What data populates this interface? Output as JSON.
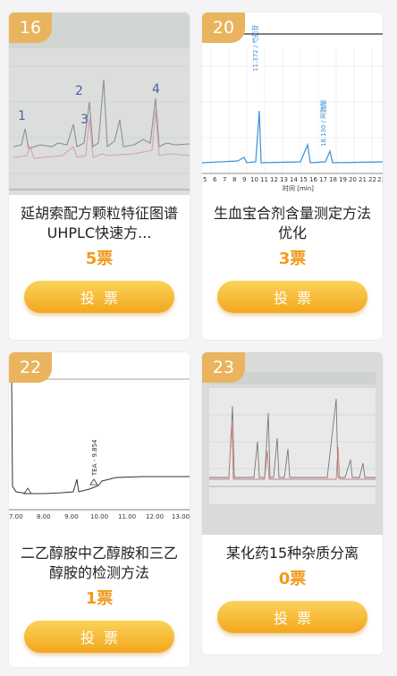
{
  "cards": [
    {
      "number": "16",
      "title": "延胡索配方颗粒特征图谱UHPLC快速方...",
      "votes": "5票",
      "vote_label": "投票",
      "peak_labels": [
        "1",
        "2",
        "3",
        "4"
      ]
    },
    {
      "number": "20",
      "title": "生血宝合剂含量测定方法优化",
      "votes": "3票",
      "vote_label": "投票",
      "axis_ticks": [
        "5",
        "6",
        "7",
        "8",
        "9",
        "10",
        "11",
        "12",
        "13",
        "14",
        "15",
        "16",
        "17",
        "18",
        "19",
        "20",
        "21",
        "22",
        "23"
      ],
      "axis_title": "时间 [min]",
      "peak_labels": [
        "11.372 / 芍药苷",
        "18.130 / 阿魏酸"
      ]
    },
    {
      "number": "22",
      "title": "二乙醇胺中乙醇胺和三乙醇胺的检测方法",
      "votes": "1票",
      "vote_label": "投票",
      "axis_ticks": [
        "7.00",
        "8.00",
        "9.00",
        "10.00",
        "11.00",
        "12.00",
        "13.00"
      ],
      "peak_labels": [
        "TEA - 9.854"
      ]
    },
    {
      "number": "23",
      "title": "某化药15种杂质分离",
      "votes": "0票",
      "vote_label": "投票"
    }
  ],
  "colors": {
    "badge": "#e9b45d",
    "votes": "#f39a1e",
    "button_top": "#fbd35a",
    "button_bottom": "#f3a71d"
  }
}
